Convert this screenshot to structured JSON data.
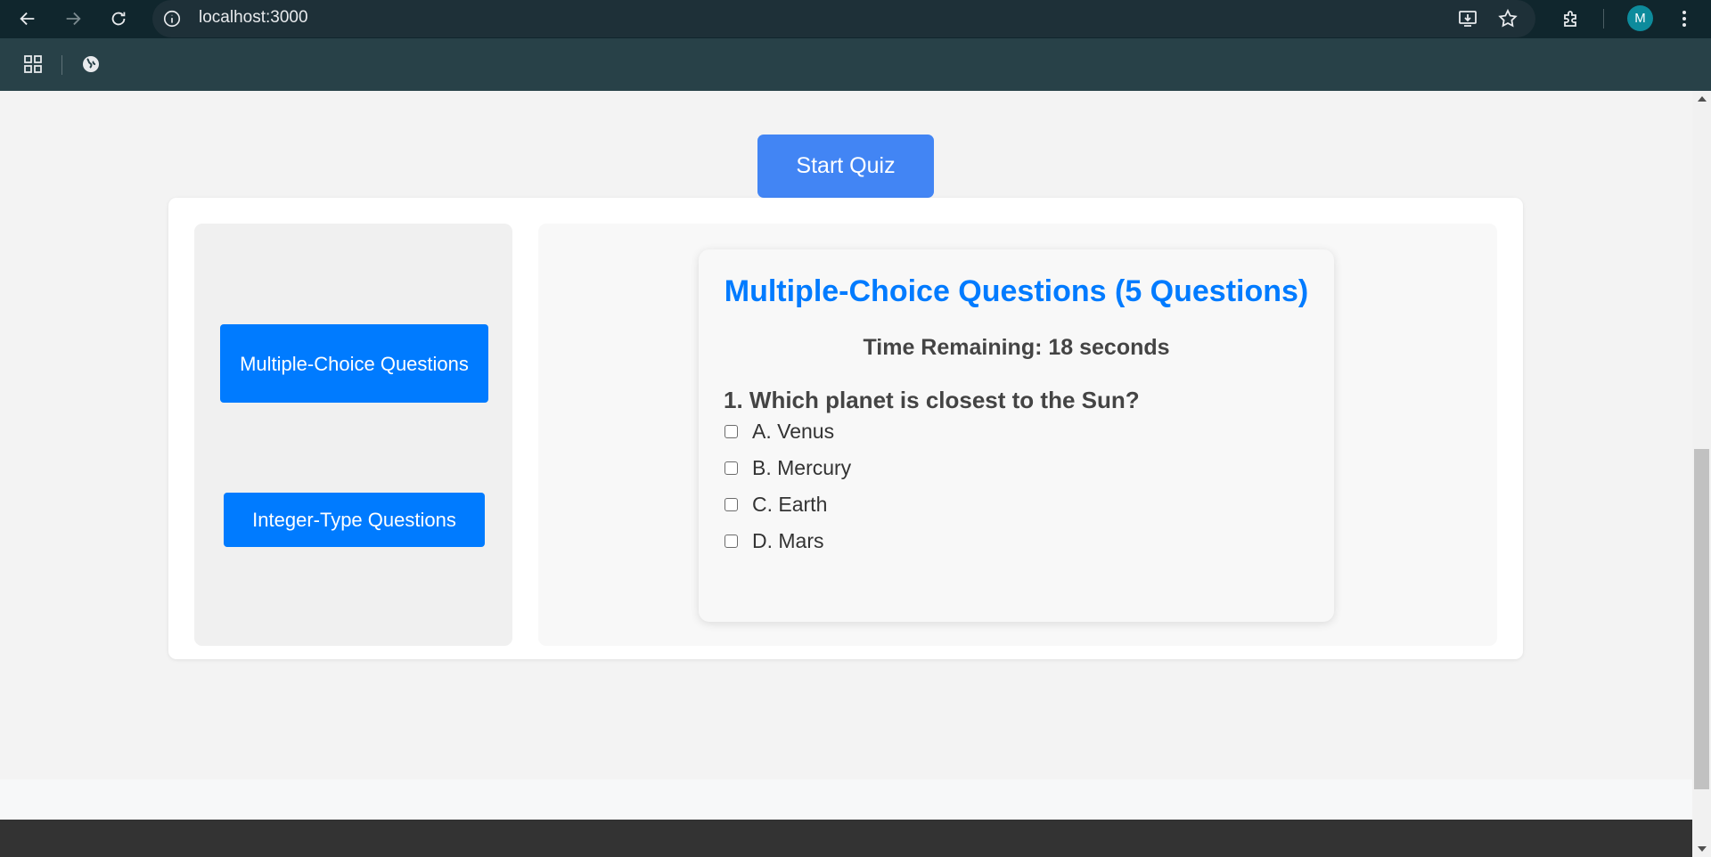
{
  "browser": {
    "url": "localhost:3000",
    "avatar_letter": "M"
  },
  "quiz": {
    "start_label": "Start Quiz",
    "sidebar": {
      "mcq_label": "Multiple-Choice Questions",
      "integer_label": "Integer-Type Questions"
    },
    "section_title": "Multiple-Choice Questions (5 Questions)",
    "timer_text": "Time Remaining: 18 seconds",
    "question": {
      "text": "1. Which planet is closest to the Sun?",
      "options": [
        {
          "label": "A. Venus",
          "checked": false
        },
        {
          "label": "B. Mercury",
          "checked": false
        },
        {
          "label": "C. Earth",
          "checked": false
        },
        {
          "label": "D. Mars",
          "checked": false
        }
      ]
    }
  },
  "colors": {
    "primary_button": "#007bff",
    "start_button": "#4285f4",
    "title_color": "#007bff"
  }
}
